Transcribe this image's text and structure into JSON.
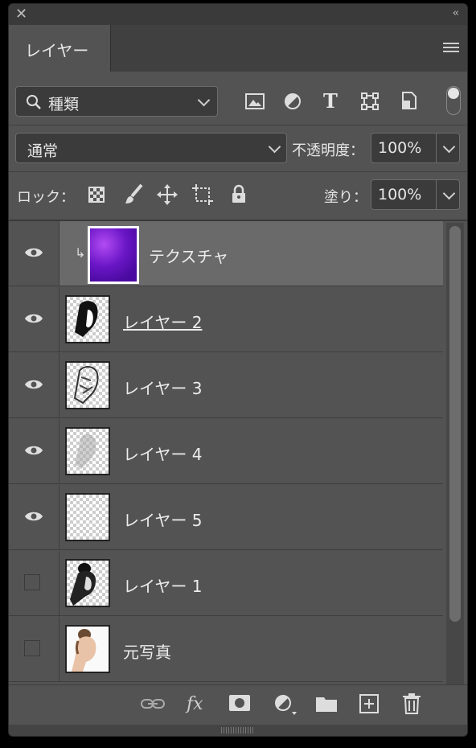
{
  "window": {
    "close_glyph": "✕",
    "collapse_glyph": "‹‹"
  },
  "tab": {
    "label": "レイヤー"
  },
  "filter": {
    "label": "種類",
    "icons": [
      "image-filter-icon",
      "adjustment-filter-icon",
      "type-filter-icon",
      "shape-filter-icon",
      "smart-object-filter-icon"
    ],
    "type_glyph": "T"
  },
  "blend": {
    "mode": "通常",
    "opacity_label": "不透明度：",
    "opacity_value": "100%"
  },
  "lock": {
    "label": "ロック：",
    "fill_label": "塗り：",
    "fill_value": "100%"
  },
  "layers": [
    {
      "name": "テクスチャ",
      "visible": true,
      "selected": true,
      "clipped": true,
      "clip_glyph": "↳",
      "thumb": "purple-texture"
    },
    {
      "name": "レイヤー 2",
      "visible": true,
      "linked": true,
      "thumb": "face-lines-dark"
    },
    {
      "name": "レイヤー 3",
      "visible": true,
      "thumb": "face-lines-mid"
    },
    {
      "name": "レイヤー 4",
      "visible": true,
      "thumb": "face-lines-light"
    },
    {
      "name": "レイヤー 5",
      "visible": true,
      "thumb": "transparent"
    },
    {
      "name": "レイヤー 1",
      "visible": false,
      "thumb": "face-bw"
    },
    {
      "name": "元写真",
      "visible": false,
      "thumb": "face-photo"
    }
  ],
  "bottom": {
    "fx_label": "fx"
  },
  "colors": {
    "panel": "#535353",
    "selected_row": "#6a6a6a",
    "texture": "#7a1fd0"
  }
}
